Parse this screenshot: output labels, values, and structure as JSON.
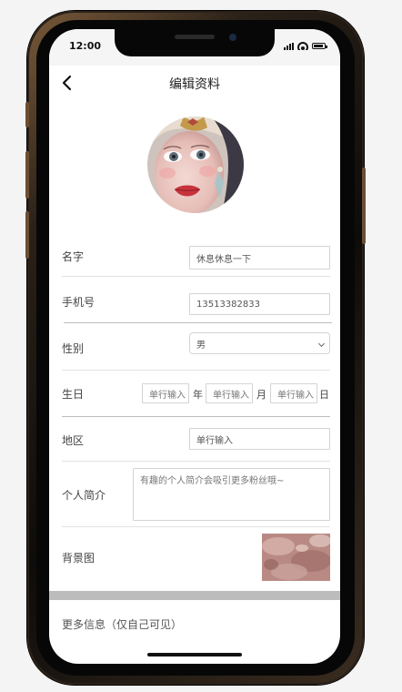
{
  "status": {
    "time": "12:00"
  },
  "nav": {
    "title": "编辑资料"
  },
  "form": {
    "name": {
      "label": "名字",
      "value": "休息休息一下"
    },
    "phone": {
      "label": "手机号",
      "value": "13513382833"
    },
    "gender": {
      "label": "性别",
      "value": "男"
    },
    "birthday": {
      "label": "生日",
      "year_placeholder": "单行输入",
      "month_placeholder": "单行输入",
      "day_placeholder": "单行输入",
      "year_unit": "年",
      "month_unit": "月",
      "day_unit": "日"
    },
    "region": {
      "label": "地区",
      "placeholder": "单行输入"
    },
    "bio": {
      "label": "个人简介",
      "placeholder": "有趣的个人简介会吸引更多粉丝哦~"
    },
    "background": {
      "label": "背景图"
    }
  },
  "more_info": {
    "label": "更多信息（仅自己可见）"
  },
  "icons": {
    "back": "chevron-left-icon",
    "signal": "signal-icon",
    "wifi": "wifi-icon",
    "battery": "battery-icon",
    "dropdown": "chevron-down-icon"
  }
}
